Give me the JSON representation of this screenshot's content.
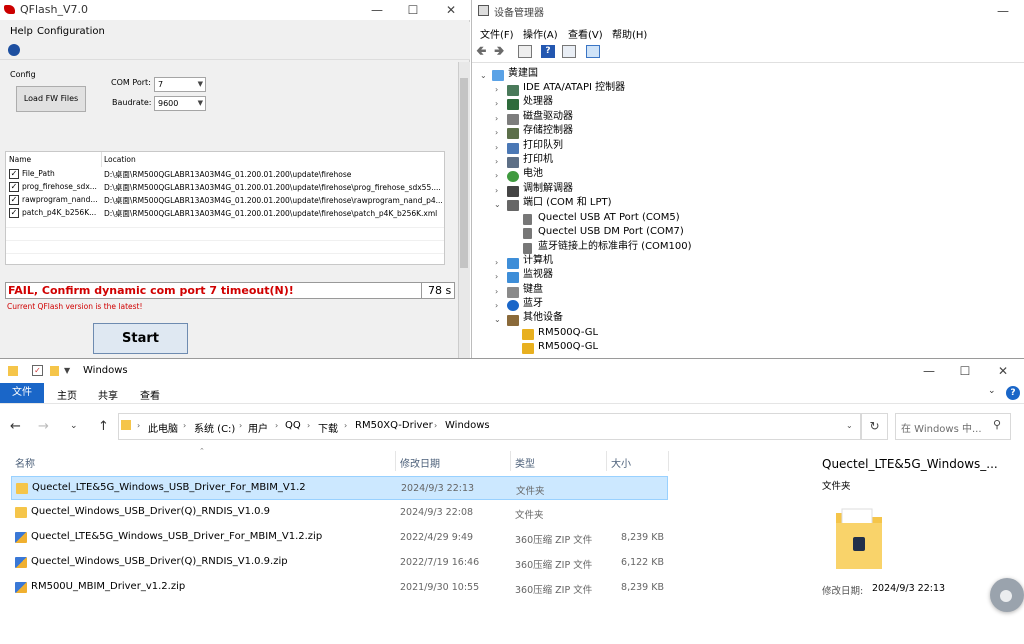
{
  "qflash": {
    "title": "QFlash_V7.0",
    "menu": [
      "Help",
      "Configuration"
    ],
    "config_label": "Config",
    "load_button": "Load FW Files",
    "com_port_label": "COM Port:",
    "com_port_value": "7",
    "baudrate_label": "Baudrate:",
    "baudrate_value": "9600",
    "table": {
      "headers": [
        "Name",
        "Location"
      ],
      "rows": [
        {
          "checked": true,
          "name": "File_Path",
          "location": "D:\\桌面\\RM500QGLABR13A03M4G_01.200.01.200\\update\\firehose"
        },
        {
          "checked": true,
          "name": "prog_firehose_sdx...",
          "location": "D:\\桌面\\RM500QGLABR13A03M4G_01.200.01.200\\update\\firehose\\prog_firehose_sdx55...."
        },
        {
          "checked": true,
          "name": "rawprogram_nand...",
          "location": "D:\\桌面\\RM500QGLABR13A03M4G_01.200.01.200\\update\\firehose\\rawprogram_nand_p4..."
        },
        {
          "checked": true,
          "name": "patch_p4K_b256K...",
          "location": "D:\\桌面\\RM500QGLABR13A03M4G_01.200.01.200\\update\\firehose\\patch_p4K_b256K.xml"
        }
      ]
    },
    "status_message": "FAIL, Confirm dynamic com port 7 timeout(N)!",
    "elapsed": "78 s",
    "version_message": "Current QFlash version is the latest!",
    "start_button": "Start",
    "colors": {
      "error": "#d00000",
      "panel": "#f0f0f0"
    }
  },
  "device_manager": {
    "title": "设备管理器",
    "menu": [
      "文件(F)",
      "操作(A)",
      "查看(V)",
      "帮助(H)"
    ],
    "tree": [
      {
        "label": "黄建国",
        "level": 0,
        "expanded": true,
        "icon": "computer-icon"
      },
      {
        "label": "IDE ATA/ATAPI 控制器",
        "level": 1,
        "expanded": false,
        "icon": "ide-controller-icon"
      },
      {
        "label": "处理器",
        "level": 1,
        "expanded": false,
        "icon": "processor-icon"
      },
      {
        "label": "磁盘驱动器",
        "level": 1,
        "expanded": false,
        "icon": "disk-drive-icon"
      },
      {
        "label": "存储控制器",
        "level": 1,
        "expanded": false,
        "icon": "storage-controller-icon"
      },
      {
        "label": "打印队列",
        "level": 1,
        "expanded": false,
        "icon": "print-queue-icon"
      },
      {
        "label": "打印机",
        "level": 1,
        "expanded": false,
        "icon": "printer-icon"
      },
      {
        "label": "电池",
        "level": 1,
        "expanded": false,
        "icon": "battery-icon"
      },
      {
        "label": "调制解调器",
        "level": 1,
        "expanded": false,
        "icon": "modem-icon"
      },
      {
        "label": "端口 (COM 和 LPT)",
        "level": 1,
        "expanded": true,
        "icon": "port-icon"
      },
      {
        "label": "Quectel USB AT Port (COM5)",
        "level": 2,
        "icon": "port-icon"
      },
      {
        "label": "Quectel USB DM Port (COM7)",
        "level": 2,
        "icon": "port-icon"
      },
      {
        "label": "蓝牙链接上的标准串行 (COM100)",
        "level": 2,
        "icon": "port-icon"
      },
      {
        "label": "计算机",
        "level": 1,
        "expanded": false,
        "icon": "computer-icon"
      },
      {
        "label": "监视器",
        "level": 1,
        "expanded": false,
        "icon": "monitor-icon"
      },
      {
        "label": "键盘",
        "level": 1,
        "expanded": false,
        "icon": "keyboard-icon"
      },
      {
        "label": "蓝牙",
        "level": 1,
        "expanded": false,
        "icon": "bluetooth-icon"
      },
      {
        "label": "其他设备",
        "level": 1,
        "expanded": true,
        "icon": "other-devices-icon"
      },
      {
        "label": "RM500Q-GL",
        "level": 2,
        "icon": "warning-device-icon"
      },
      {
        "label": "RM500Q-GL",
        "level": 2,
        "icon": "warning-device-icon"
      }
    ]
  },
  "explorer": {
    "title": "Windows",
    "ribbon_tabs": [
      "文件",
      "主页",
      "共享",
      "查看"
    ],
    "breadcrumb": [
      "此电脑",
      "系统 (C:)",
      "用户",
      "QQ",
      "下载",
      "RM50XQ-Driver",
      "Windows"
    ],
    "search_placeholder": "在 Windows 中...",
    "columns": [
      "名称",
      "修改日期",
      "类型",
      "大小"
    ],
    "files": [
      {
        "name": "Quectel_LTE&5G_Windows_USB_Driver_For_MBIM_V1.2",
        "date": "2024/9/3 22:13",
        "type": "文件夹",
        "size": "",
        "kind": "folder",
        "selected": true
      },
      {
        "name": "Quectel_Windows_USB_Driver(Q)_RNDIS_V1.0.9",
        "date": "2024/9/3 22:08",
        "type": "文件夹",
        "size": "",
        "kind": "folder",
        "selected": false
      },
      {
        "name": "Quectel_LTE&5G_Windows_USB_Driver_For_MBIM_V1.2.zip",
        "date": "2022/4/29 9:49",
        "type": "360压缩 ZIP 文件",
        "size": "8,239 KB",
        "kind": "zip",
        "selected": false
      },
      {
        "name": "Quectel_Windows_USB_Driver(Q)_RNDIS_V1.0.9.zip",
        "date": "2022/7/19 16:46",
        "type": "360压缩 ZIP 文件",
        "size": "6,122 KB",
        "kind": "zip",
        "selected": false
      },
      {
        "name": "RM500U_MBIM_Driver_v1.2.zip",
        "date": "2021/9/30 10:55",
        "type": "360压缩 ZIP 文件",
        "size": "8,239 KB",
        "kind": "zip",
        "selected": false
      }
    ],
    "preview": {
      "title": "Quectel_LTE&5G_Windows_...",
      "type": "文件夹",
      "modified_label": "修改日期:",
      "modified_value": "2024/9/3 22:13"
    },
    "colors": {
      "accent": "#1a66c8",
      "selection": "#cce8ff",
      "folder": "#f5c54a"
    }
  }
}
